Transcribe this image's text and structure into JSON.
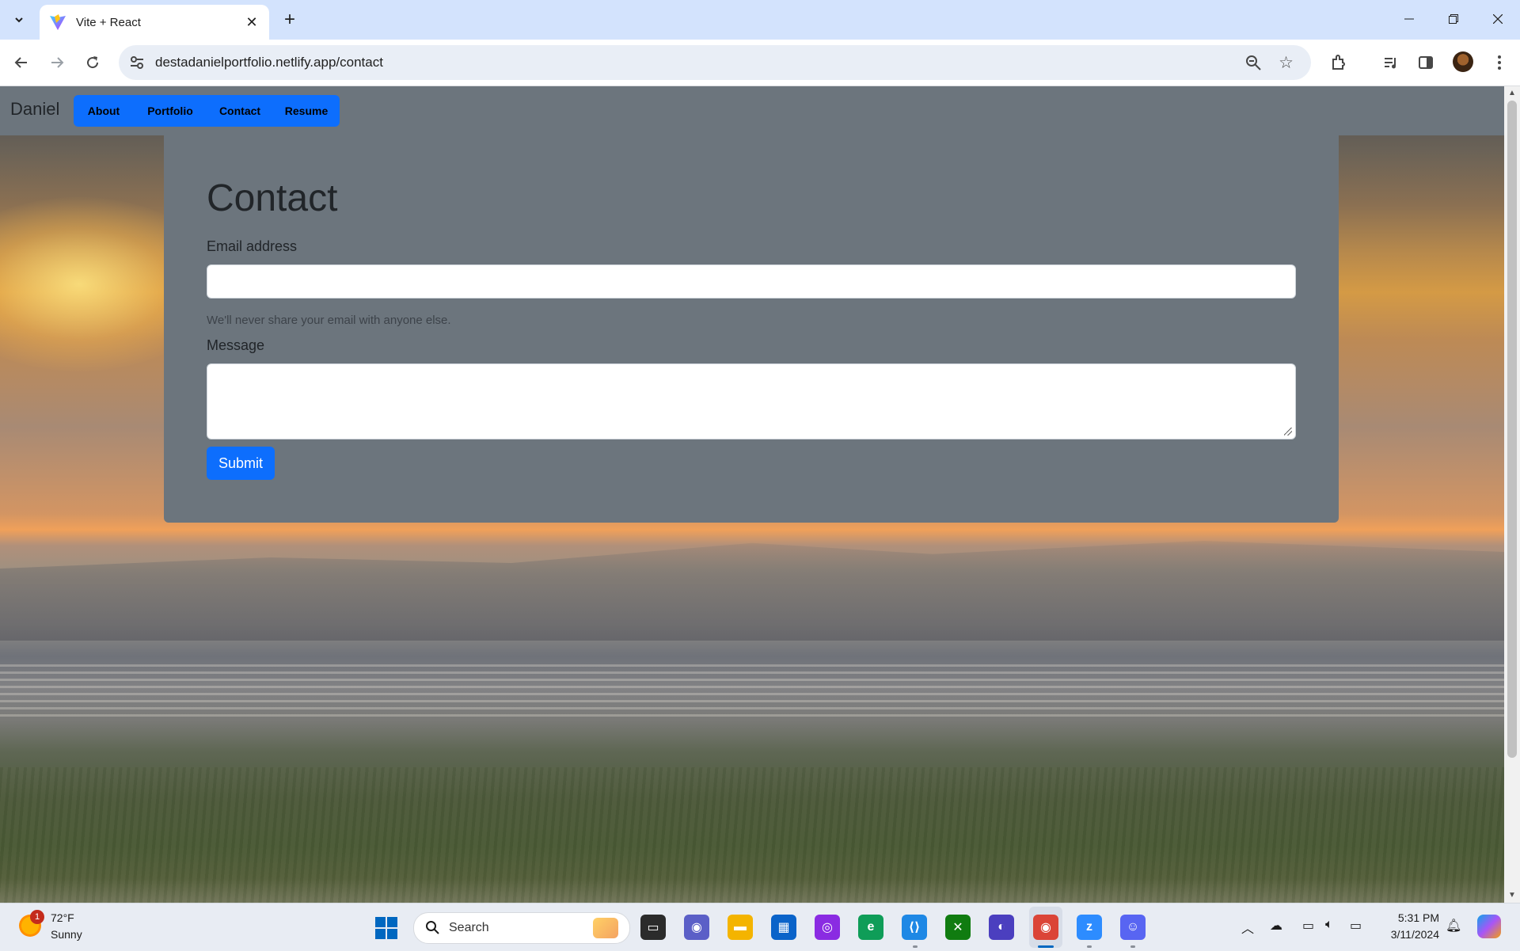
{
  "browser": {
    "tab_title": "Vite + React",
    "url": "destadanielportfolio.netlify.app/contact"
  },
  "navbar": {
    "brand": "Daniel",
    "links": [
      {
        "label": "About"
      },
      {
        "label": "Portfolio"
      },
      {
        "label": "Contact"
      },
      {
        "label": "Resume"
      }
    ]
  },
  "form": {
    "title": "Contact",
    "email_label": "Email address",
    "email_value": "",
    "email_help": "We'll never share your email with anyone else.",
    "message_label": "Message",
    "message_value": "",
    "submit_label": "Submit"
  },
  "taskbar": {
    "weather_temp": "72°F",
    "weather_condition": "Sunny",
    "weather_badge": "1",
    "search_placeholder": "Search",
    "time": "5:31 PM",
    "date": "3/11/2024"
  },
  "colors": {
    "accent_blue": "#0d6efd",
    "navbar_gray": "#6c757d",
    "chrome_tabstrip": "#d3e3fd"
  }
}
